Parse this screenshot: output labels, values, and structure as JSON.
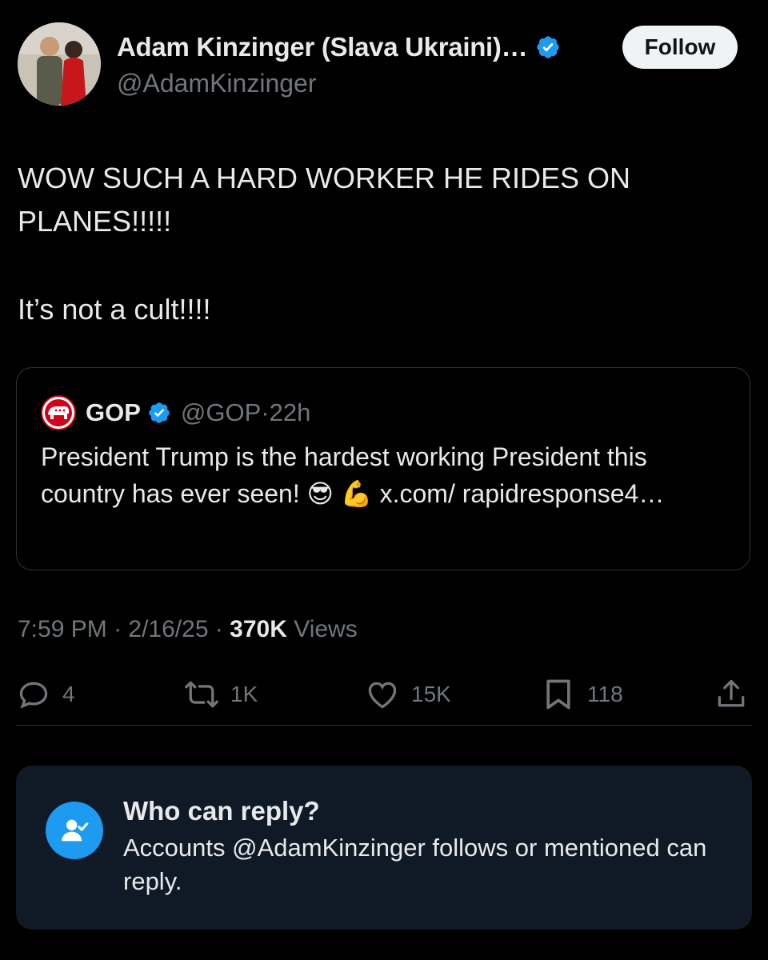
{
  "author": {
    "name": "Adam Kinzinger (Slava Ukraini)…",
    "handle": "@AdamKinzinger",
    "follow_label": "Follow",
    "avatar_icon": "profile-photo"
  },
  "tweet": {
    "line1": "WOW SUCH A HARD WORKER HE RIDES ON PLANES!!!!!",
    "line2": "It’s not a cult!!!!"
  },
  "quote": {
    "name": "GOP",
    "handle": "@GOP",
    "separator": "·",
    "time": "22h",
    "text": "President Trump is the hardest working President this country has ever seen! 😎 💪 x.com/ rapidresponse4…"
  },
  "meta": {
    "time": "7:59 PM",
    "date": "2/16/25",
    "views_count": "370K",
    "views_label": "Views"
  },
  "actions": {
    "replies": "4",
    "reposts": "1K",
    "likes": "15K",
    "bookmarks": "118"
  },
  "reply_settings": {
    "title": "Who can reply?",
    "description": "Accounts @AdamKinzinger follows or mentioned can reply."
  },
  "colors": {
    "background": "#000000",
    "accent": "#1d9bf0",
    "secondary_text": "#71767b",
    "reply_box": "#0f1a26"
  }
}
